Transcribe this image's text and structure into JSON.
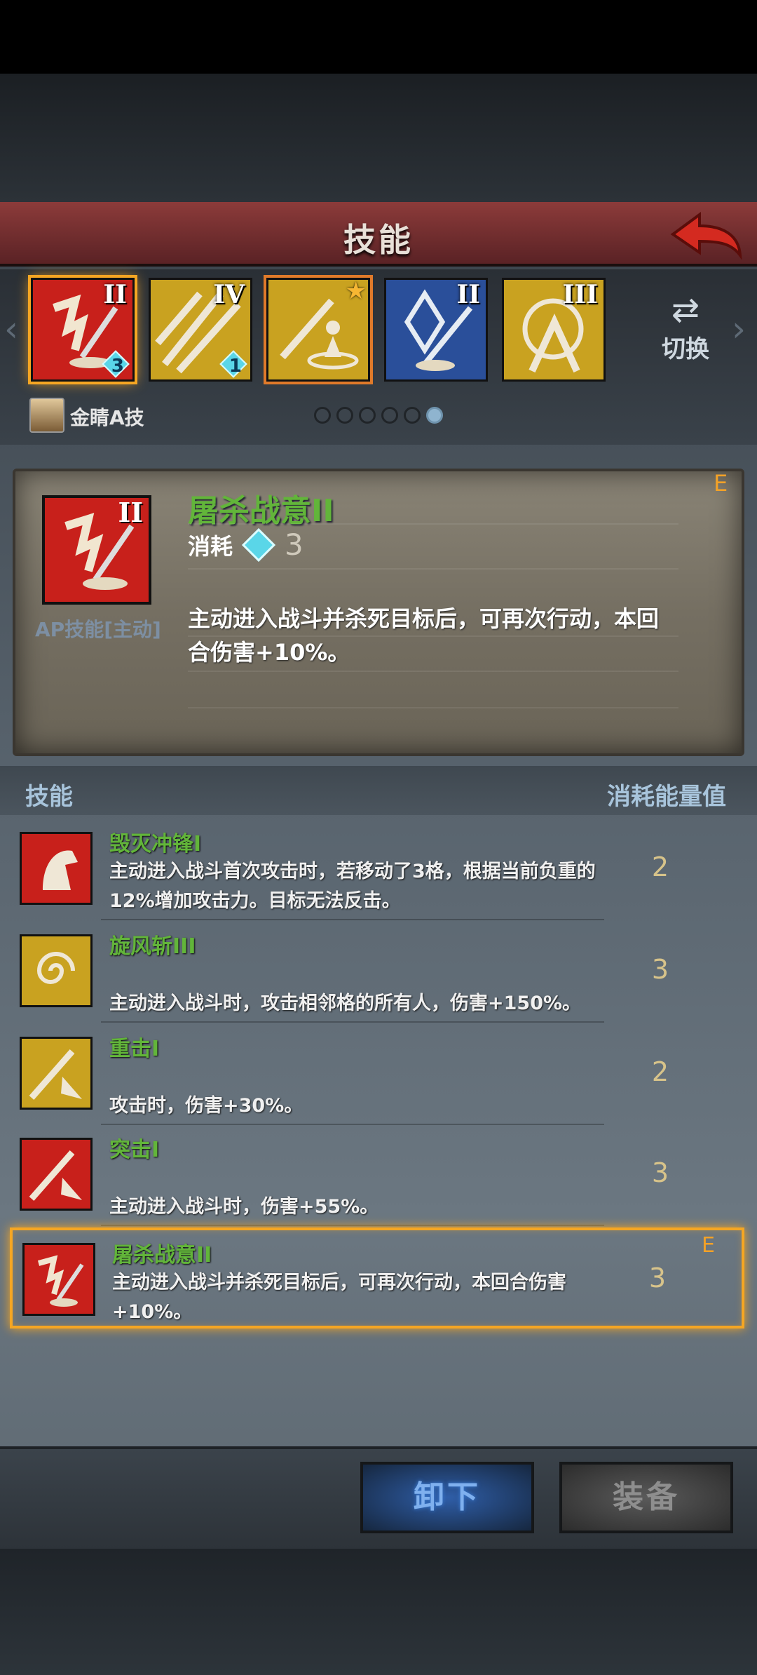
{
  "header": {
    "title": "技能"
  },
  "equipped_slots": [
    {
      "roman": "II",
      "count": "3",
      "color": "#c8201b"
    },
    {
      "roman": "IV",
      "count": "1",
      "color": "#c9a220"
    },
    {
      "roman": "",
      "count": "",
      "color": "#c9a220"
    },
    {
      "roman": "II",
      "count": "",
      "color": "#2a4f9a"
    },
    {
      "roman": "III",
      "count": "",
      "color": "#c9a220"
    }
  ],
  "switch_label": "切换",
  "hero": {
    "name": "金睛A技"
  },
  "pager": {
    "pages": 6,
    "current": 6
  },
  "detail": {
    "grade": "E",
    "roman": "II",
    "name": "屠杀战意II",
    "type_label": "AP技能[主动]",
    "cost_label": "消耗",
    "cost": "3",
    "description": "主动进入战斗并杀死目标后，可再次行动，本回合伤害+10%。"
  },
  "list": {
    "col_skill": "技能",
    "col_cost": "消耗能量值",
    "items": [
      {
        "name": "毁灭冲锋I",
        "desc": "主动进入战斗首次攻击时，若移动了3格，根据当前负重的12%增加攻击力。目标无法反击。",
        "cost": "2",
        "color": "#c8201b",
        "icon": "charge-icon"
      },
      {
        "name": "旋风斩III",
        "desc": "主动进入战斗时，攻击相邻格的所有人，伤害+150%。",
        "cost": "3",
        "color": "#c9a220",
        "icon": "whirlwind-icon"
      },
      {
        "name": "重击I",
        "desc": "攻击时，伤害+30%。",
        "cost": "2",
        "color": "#c9a220",
        "icon": "heavy-strike-icon"
      },
      {
        "name": "突击I",
        "desc": "主动进入战斗时，伤害+55%。",
        "cost": "3",
        "color": "#c8201b",
        "icon": "assault-icon"
      },
      {
        "name": "屠杀战意II",
        "desc": "主动进入战斗并杀死目标后，可再次行动，本回合伤害+10%。",
        "cost": "3",
        "color": "#c8201b",
        "icon": "slaughter-icon",
        "grade": "E"
      }
    ]
  },
  "buttons": {
    "unequip": "卸下",
    "equip": "装备"
  }
}
